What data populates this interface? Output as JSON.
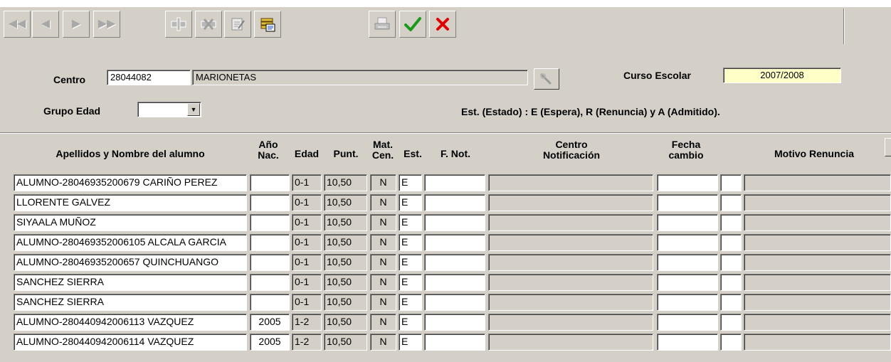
{
  "form": {
    "centro_label": "Centro",
    "centro_code": "28044082",
    "centro_name": "MARIONETAS",
    "curso_label": "Curso Escolar",
    "curso_value": "2007/2008",
    "grupo_label": "Grupo Edad",
    "grupo_value": "",
    "estado_note": "Est. (Estado) : E (Espera), R (Renuncia) y A (Admitido)."
  },
  "table": {
    "headers": {
      "nombre": "Apellidos y Nombre del alumno",
      "anio_1": "Año",
      "anio_2": "Nac.",
      "edad": "Edad",
      "punt": "Punt.",
      "mat_1": "Mat.",
      "mat_2": "Cen.",
      "est": "Est.",
      "fnot": "F. Not.",
      "centro_1": "Centro",
      "centro_2": "Notificación",
      "fecha_1": "Fecha",
      "fecha_2": "cambio",
      "motivo": "Motivo Renuncia"
    },
    "rows": [
      {
        "nombre": "ALUMNO-28046935200679 CARIÑO PEREZ",
        "anio": "",
        "edad": "0-1",
        "punt": "10,50",
        "mat": "N",
        "est": "E"
      },
      {
        "nombre": "LLORENTE GALVEZ",
        "anio": "",
        "edad": "0-1",
        "punt": "10,50",
        "mat": "N",
        "est": "E"
      },
      {
        "nombre": "SIYAALA MUÑOZ",
        "anio": "",
        "edad": "0-1",
        "punt": "10,50",
        "mat": "N",
        "est": "E"
      },
      {
        "nombre": "ALUMNO-280469352006105 ALCALA GARCIA",
        "anio": "",
        "edad": "0-1",
        "punt": "10,50",
        "mat": "N",
        "est": "E"
      },
      {
        "nombre": "ALUMNO-28046935200657 QUINCHUANGO",
        "anio": "",
        "edad": "0-1",
        "punt": "10,50",
        "mat": "N",
        "est": "E"
      },
      {
        "nombre": "SANCHEZ SIERRA",
        "anio": "",
        "edad": "0-1",
        "punt": "10,50",
        "mat": "N",
        "est": "E"
      },
      {
        "nombre": "SANCHEZ SIERRA",
        "anio": "",
        "edad": "0-1",
        "punt": "10,50",
        "mat": "N",
        "est": "E"
      },
      {
        "nombre": "ALUMNO-280440942006113 VAZQUEZ",
        "anio": "2005",
        "edad": "1-2",
        "punt": "10,50",
        "mat": "N",
        "est": "E"
      },
      {
        "nombre": "ALUMNO-280440942006114 VAZQUEZ",
        "anio": "2005",
        "edad": "1-2",
        "punt": "10,50",
        "mat": "N",
        "est": "E"
      }
    ]
  },
  "colors": {
    "window_bg": "#d4d0c8",
    "readonly_yellow": "#ffffc8",
    "accept_green": "#1a9a1a",
    "cancel_red": "#e00000"
  },
  "icons": [
    "first-record-icon",
    "prev-record-icon",
    "next-record-icon",
    "last-record-icon",
    "insert-record-icon",
    "delete-record-icon",
    "edit-note-icon",
    "database-icon",
    "print-icon",
    "accept-check-icon",
    "cancel-x-icon",
    "search-lookup-icon",
    "chevron-down-icon"
  ]
}
